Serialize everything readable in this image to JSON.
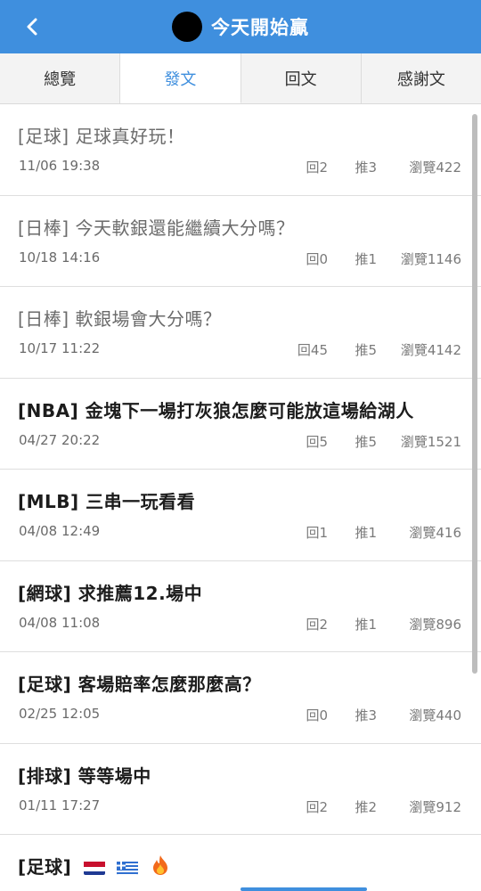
{
  "header": {
    "title": "今天開始贏",
    "back_icon": "chevron-left-icon",
    "colors": {
      "primary": "#3f8fde"
    }
  },
  "tabs": [
    {
      "label": "總覽",
      "active": false
    },
    {
      "label": "發文",
      "active": true
    },
    {
      "label": "回文",
      "active": false
    },
    {
      "label": "感謝文",
      "active": false
    }
  ],
  "posts": [
    {
      "title": "[足球] 足球真好玩！",
      "date": "11/06 19:38",
      "replies": "回2",
      "likes": "推3",
      "views": "瀏覽422",
      "read": true
    },
    {
      "title": "[日棒] 今天軟銀還能繼續大分嗎？",
      "date": "10/18 14:16",
      "replies": "回0",
      "likes": "推1",
      "views": "瀏覽1146",
      "read": true
    },
    {
      "title": "[日棒] 軟銀場會大分嗎？",
      "date": "10/17 11:22",
      "replies": "回45",
      "likes": "推5",
      "views": "瀏覽4142",
      "read": true
    },
    {
      "title": "[NBA] 金塊下一場打灰狼怎麼可能放這場給湖人",
      "date": "04/27 20:22",
      "replies": "回5",
      "likes": "推5",
      "views": "瀏覽1521",
      "read": false
    },
    {
      "title": "[MLB] 三串一玩看看",
      "date": "04/08 12:49",
      "replies": "回1",
      "likes": "推1",
      "views": "瀏覽416",
      "read": false
    },
    {
      "title": "[網球] 求推薦12.場中",
      "date": "04/08 11:08",
      "replies": "回2",
      "likes": "推1",
      "views": "瀏覽896",
      "read": false
    },
    {
      "title": "[足球] 客場賠率怎麼那麼高？",
      "date": "02/25 12:05",
      "replies": "回0",
      "likes": "推3",
      "views": "瀏覽440",
      "read": false
    },
    {
      "title": "[排球] 等等場中",
      "date": "01/11 17:27",
      "replies": "回2",
      "likes": "推2",
      "views": "瀏覽912",
      "read": false
    }
  ],
  "last_post": {
    "title": "[足球]",
    "emoji": [
      "netherlands-flag-icon",
      "greece-flag-icon",
      "fire-icon"
    ]
  }
}
